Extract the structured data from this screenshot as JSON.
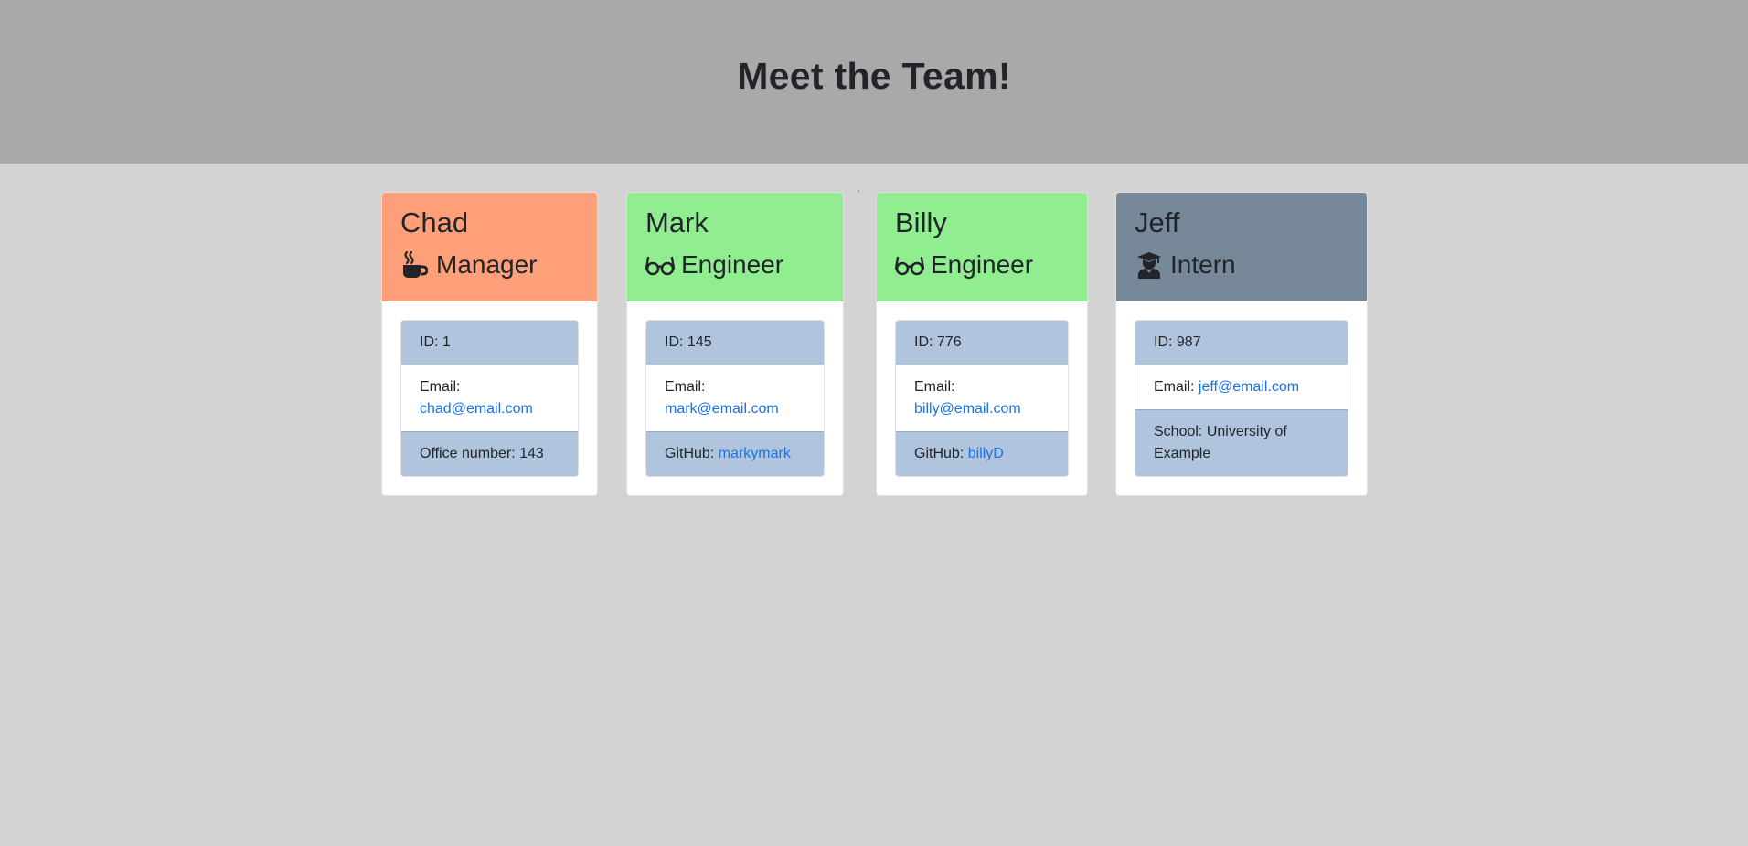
{
  "header": {
    "title": "Meet the Team!"
  },
  "colors": {
    "manager": "#ffa07a",
    "engineer": "#90ee90",
    "intern": "#778899",
    "list_shade": "#b0c4de",
    "link": "#1a73e8"
  },
  "cards": [
    {
      "name": "Chad",
      "role": "Manager",
      "icon": "coffee-icon",
      "id_text": "ID: 1",
      "email_label": "Email:",
      "email": "chad@email.com",
      "extra_label": "Office number: 143",
      "extra_value": ""
    },
    {
      "name": "Mark",
      "role": "Engineer",
      "icon": "glasses-icon",
      "id_text": "ID: 145",
      "email_label": "Email:",
      "email": "mark@email.com",
      "extra_label": "GitHub:",
      "extra_value": "markymark"
    },
    {
      "name": "Billy",
      "role": "Engineer",
      "icon": "glasses-icon",
      "id_text": "ID: 776",
      "email_label": "Email:",
      "email": "billy@email.com",
      "extra_label": "GitHub:",
      "extra_value": "billyD"
    },
    {
      "name": "Jeff",
      "role": "Intern",
      "icon": "graduate-icon",
      "id_text": "ID: 987",
      "email_label": "Email:",
      "email": "jeff@email.com",
      "extra_label": "School: University of Example",
      "extra_value": ""
    }
  ],
  "stray_mark": "'"
}
